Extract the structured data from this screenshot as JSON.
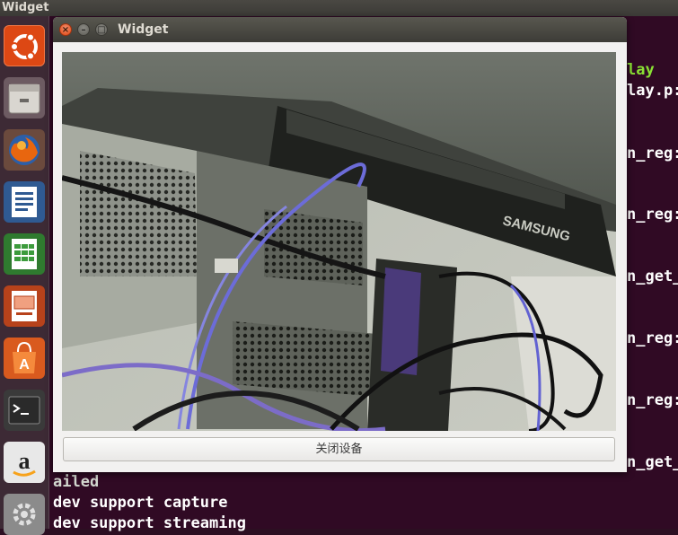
{
  "top_panel": {
    "title": "Widget"
  },
  "window": {
    "title": "Widget",
    "close_symbol": "×",
    "minimize_symbol": "–",
    "maximize_symbol": "□",
    "close_device_button": "关闭设备",
    "camera_logo_text": "SAMSUNG"
  },
  "terminal": {
    "right_lines": [
      "lay",
      "lay.p:",
      "n_reg:",
      "n_reg:",
      "n_get_",
      "n_reg:",
      "n_reg:",
      "n_get_"
    ],
    "bottom_lines": [
      "ailed",
      "dev support capture",
      "dev support streaming"
    ]
  },
  "launcher": {
    "items": [
      "ubuntu-logo-icon",
      "file-manager-icon",
      "firefox-icon",
      "writer-icon",
      "calc-icon",
      "impress-icon",
      "software-center-icon",
      "terminal-icon",
      "amazon-icon",
      "settings-icon"
    ]
  },
  "colors": {
    "terminal_bg": "#300a24",
    "accent_orange": "#df4a16",
    "terminal_green": "#8ae234"
  }
}
